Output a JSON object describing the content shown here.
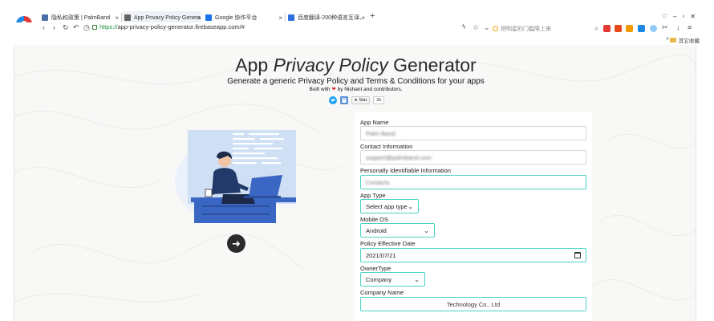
{
  "tabs": [
    {
      "title": "隐私权政策 | PalmBand",
      "favicon_color": "#4a6fa5",
      "active": false
    },
    {
      "title": "App Privacy Policy Generator",
      "favicon_color": "#555555",
      "active": true
    },
    {
      "title": "Google 协作平台",
      "favicon_color": "#1a73e8",
      "active": false
    },
    {
      "title": "百度翻译-200种语言互译、沟通...",
      "favicon_color": "#2f6fde",
      "active": false
    }
  ],
  "address": {
    "scheme": "https://",
    "rest": "app-privacy-policy-generator.firebaseapp.com/#"
  },
  "search": {
    "placeholder": "把明星的门槛降上来"
  },
  "bookmarks": {
    "folder_label": "其它收藏",
    "more": "»"
  },
  "header": {
    "title_plain": "App ",
    "title_italic": "Privacy Policy",
    "title_rest": " Generator",
    "subtitle": "Generate a generic Privacy Policy and Terms & Conditions for your apps",
    "built_prefix": "Built with",
    "built_suffix": "by Nishant and contributors.",
    "github_star": "Star",
    "github_count": "2k"
  },
  "colors": {
    "accent": "#4ad3c0",
    "illustration_blue": "#3a66c4",
    "illustration_light": "#cfe0f5"
  },
  "form": {
    "app_name": {
      "label": "App Name",
      "value": "Palm Band"
    },
    "contact": {
      "label": "Contact Information",
      "value": "support@palmband.com"
    },
    "pii": {
      "label": "Personally Identifiable Information",
      "value": "Contacts"
    },
    "app_type": {
      "label": "App Type",
      "value": "Select app type"
    },
    "mobile_os": {
      "label": "Mobile OS",
      "value": "Android"
    },
    "effective_date": {
      "label": "Policy Effective Date",
      "value": "2021/07/21"
    },
    "owner_type": {
      "label": "OwnerType",
      "value": "Company"
    },
    "company_name": {
      "label": "Company Name",
      "value": "Technology Co., Ltd"
    }
  },
  "next_icon": "arrow-right-icon"
}
